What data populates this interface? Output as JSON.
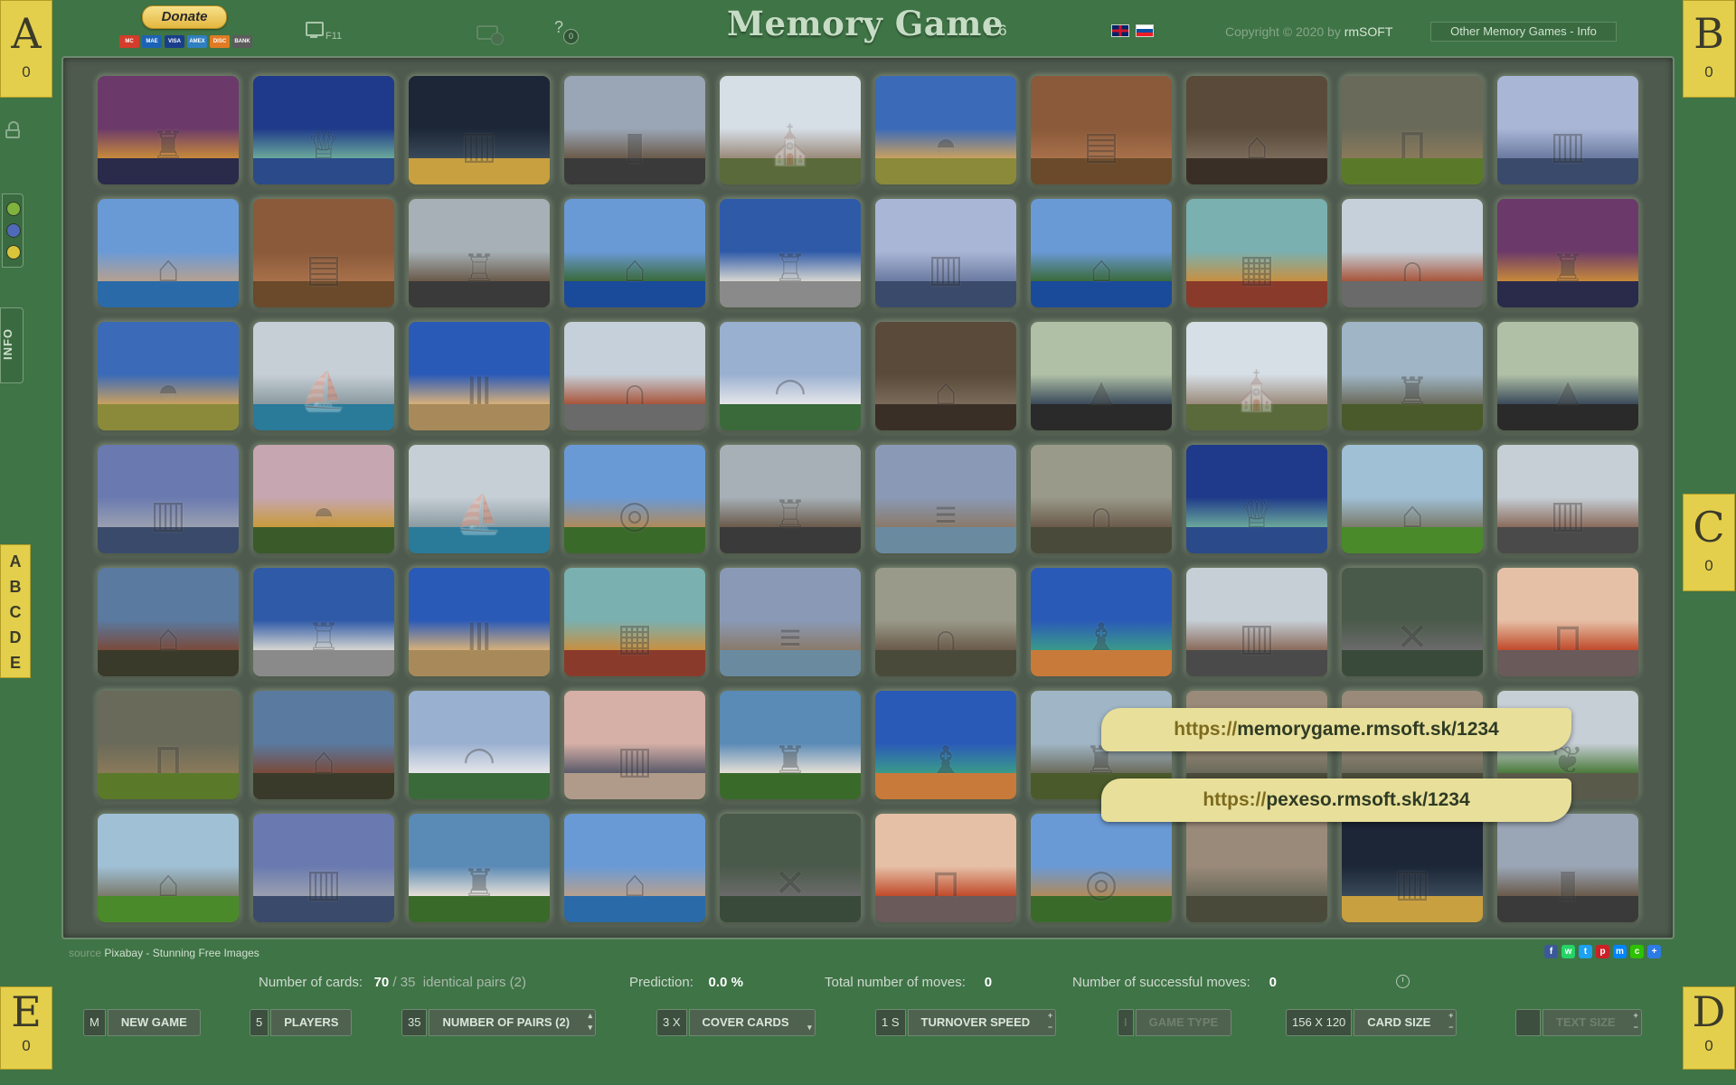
{
  "header": {
    "donate_label": "Donate",
    "payment_cards": [
      "MC",
      "MAE",
      "VISA",
      "AMEX",
      "DISC",
      "BANK"
    ],
    "fullscreen_key": "F11",
    "help_badge": "0",
    "title": "Memory Game",
    "version": "1.6",
    "copyright_prefix": "Copyright © 2020 by",
    "copyright_brand": "rmSOFT",
    "other_games_label": "Other Memory Games - Info"
  },
  "players": {
    "A": {
      "letter": "A",
      "score": "0"
    },
    "B": {
      "letter": "B",
      "score": "0"
    },
    "C": {
      "letter": "C",
      "score": "0"
    },
    "D": {
      "letter": "D",
      "score": "0"
    },
    "E": {
      "letter": "E",
      "score": "0"
    }
  },
  "sidebar": {
    "info_label": "INFO",
    "player_letters": [
      "A",
      "B",
      "C",
      "D",
      "E"
    ],
    "theme_colors": [
      "#7fb33e",
      "#4f6ab8",
      "#d9c43a"
    ]
  },
  "cards": [
    "prague-castle",
    "statue-of-liberty",
    "boston-harbor",
    "street-canyon",
    "gothic-church",
    "castel-sant-angelo",
    "kasbah",
    "baroque-facade",
    "stonehenge",
    "manhattan",
    "cinque-terre",
    "kasbah",
    "empire-state",
    "coastal-village",
    "palacio-cibeles",
    "manhattan",
    "coastal-village",
    "colorful-cafe",
    "arc-de-triomf",
    "prague-castle",
    "castel-sant-angelo",
    "monaco-harbor",
    "parthenon",
    "arc-de-triomf",
    "taj-mahal",
    "baroque-facade",
    "temple-of-heaven",
    "gothic-church",
    "castle-town-hall",
    "temple-of-heaven",
    "hong-kong",
    "st-isaac-dome",
    "monaco-harbor",
    "colosseum",
    "empire-state",
    "charles-bridge",
    "ruined-abbey",
    "statue-of-liberty",
    "village-barn",
    "city-street",
    "canal-houses",
    "palacio-cibeles",
    "parthenon",
    "colorful-cafe",
    "charles-bridge",
    "ruined-abbey",
    "onion-domes",
    "city-street",
    "highway-interchange",
    "golden-gate",
    "stonehenge",
    "canal-houses",
    "taj-mahal",
    "skyline-sunset",
    "bratislava-castle",
    "onion-domes",
    "castle-town-hall",
    "hidden",
    "hidden",
    "ivy-alley",
    "village-barn",
    "hong-kong",
    "bratislava-castle",
    "cinque-terre",
    "highway-interchange",
    "golden-gate",
    "colosseum",
    "hidden",
    "boston-harbor",
    "street-canyon"
  ],
  "banners": [
    {
      "protocol": "https://",
      "rest": "memorygame.rmsoft.sk/1234"
    },
    {
      "protocol": "https://",
      "rest": "pexeso.rmsoft.sk/1234"
    }
  ],
  "source": {
    "prefix": "source",
    "name": "Pixabay - Stunning Free Images"
  },
  "share_icons": [
    "facebook-icon",
    "whatsapp-icon",
    "twitter-icon",
    "pinterest-icon",
    "messenger-icon",
    "wechat-icon",
    "more-share-icon"
  ],
  "stats": {
    "cards_label": "Number of cards:",
    "cards_value": "70",
    "pairs_value": "/ 35",
    "pairs_label": "identical pairs (2)",
    "prediction_label": "Prediction:",
    "prediction_value": "0.0 %",
    "moves_label": "Total number of moves:",
    "moves_value": "0",
    "success_label": "Number of successful moves:",
    "success_value": "0"
  },
  "controls": {
    "new_game": {
      "num": "M",
      "label": "New game"
    },
    "players": {
      "num": "5",
      "label": "Players"
    },
    "pairs": {
      "num": "35",
      "label": "Number of pairs (2)"
    },
    "cover": {
      "num": "3 x",
      "label": "Cover cards"
    },
    "speed": {
      "num": "1 s",
      "label": "Turnover speed"
    },
    "game_type": {
      "num": "I",
      "label": "Game type"
    },
    "card_size": {
      "num": "156 x 120",
      "label": "Card size"
    },
    "text_size": {
      "num": "",
      "label": "Text size"
    }
  }
}
